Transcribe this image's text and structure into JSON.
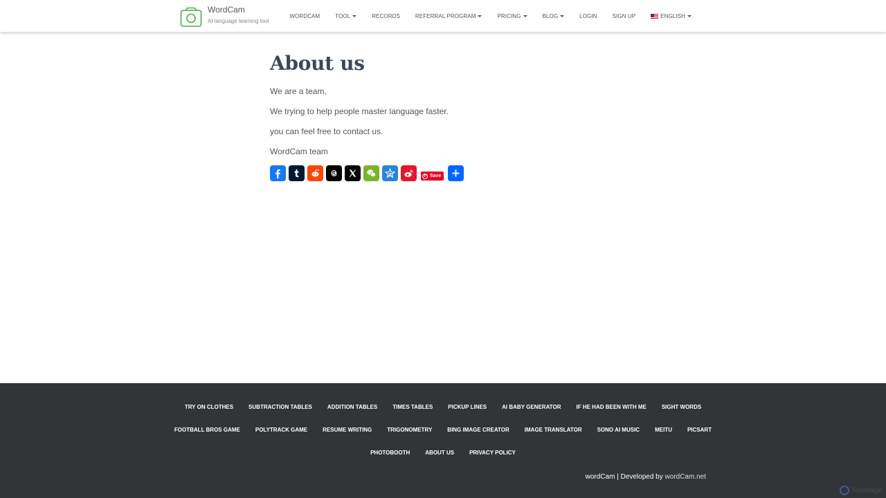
{
  "brand": {
    "name": "WordCam",
    "tagline": "AI language learning tool"
  },
  "nav": {
    "items": [
      {
        "label": "WORDCAM",
        "dropdown": false
      },
      {
        "label": "TOOL",
        "dropdown": true
      },
      {
        "label": "RECORDS",
        "dropdown": false
      },
      {
        "label": "REFERRAL PROGRAM",
        "dropdown": true
      },
      {
        "label": "PRICING",
        "dropdown": true
      },
      {
        "label": "BLOG",
        "dropdown": true
      },
      {
        "label": "LOGIN",
        "dropdown": false
      },
      {
        "label": "SIGN UP",
        "dropdown": false
      }
    ],
    "language": "ENGLISH"
  },
  "content": {
    "title": "About us",
    "paragraphs": [
      "We are a team,",
      "We trying to help people master language faster.",
      "you can feel free to contact us.",
      "WordCam team"
    ],
    "share": {
      "buttons": [
        {
          "icon": "facebook-icon",
          "color": "#1877f2"
        },
        {
          "icon": "tumblr-icon",
          "color": "#001935"
        },
        {
          "icon": "reddit-icon",
          "color": "#ff4500"
        },
        {
          "icon": "threads-icon",
          "color": "#000000"
        },
        {
          "icon": "x-icon",
          "color": "#000000"
        },
        {
          "icon": "wechat-icon",
          "color": "#7bb32e"
        },
        {
          "icon": "qzone-icon",
          "color": "#2b82d9"
        },
        {
          "icon": "weibo-icon",
          "color": "#e6162d"
        },
        {
          "icon": "share-plus-icon",
          "color": "#0166ff"
        }
      ],
      "pinterest_save_label": "Save"
    }
  },
  "footer": {
    "links": [
      "TRY ON CLOTHES",
      "SUBTRACTION TABLES",
      "ADDITION TABLES",
      "TIMES TABLES",
      "PICKUP LINES",
      "AI BABY GENERATOR",
      "IF HE HAD BEEN WITH ME",
      "SIGHT WORDS",
      "FOOTBALL BROS GAME",
      "POLYTRACK GAME",
      "RESUME WRITING",
      "TRIGONOMETRY",
      "BING IMAGE CREATOR",
      "IMAGE TRANSLATOR",
      "SONO AI MUSIC",
      "MEITU",
      "PICSART",
      "PHOTOBOOTH",
      "ABOUT US",
      "PRIVACY POLICY"
    ],
    "credit_site": "wordCam",
    "credit_separator": " | Developed by ",
    "credit_link": "wordCam.net",
    "watermark": "ToolMage"
  },
  "colors": {
    "footer_bg": "#333438",
    "logo_green": "#5cb85c",
    "title": "#3c4858"
  }
}
